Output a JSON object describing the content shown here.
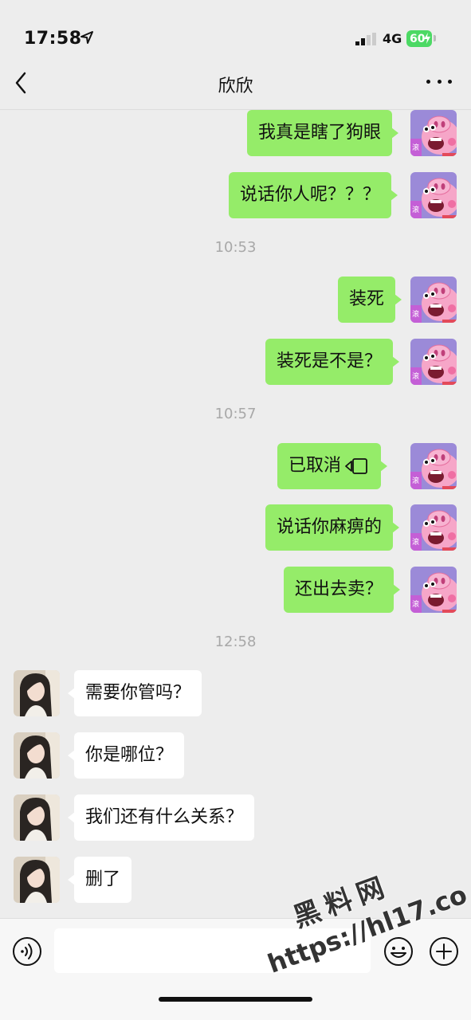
{
  "status": {
    "time": "17:58",
    "network": "4G",
    "battery": "60"
  },
  "nav": {
    "title": "欣欣"
  },
  "messages": {
    "m1": "我真是瞎了狗眼",
    "m2": "说话你人呢？？？",
    "t1": "10:53",
    "m3": "装死",
    "m4": "装死是不是？",
    "t2": "10:57",
    "m5": "已取消",
    "m6": "说话你麻痹的",
    "m7": "还出去卖？",
    "t3": "12:58",
    "r1": "需要你管吗？",
    "r2": "你是哪位？",
    "r3": "我们还有什么关系？",
    "r4": "删了"
  },
  "avatar_badge": "滚",
  "input": {
    "value": ""
  },
  "watermark": {
    "line1": "黑料网",
    "line2": "https://hl17.co"
  },
  "colors": {
    "outgoing": "#95ec69",
    "incoming": "#ffffff",
    "background": "#ededed"
  },
  "icons": [
    "back-chevron",
    "more-dots",
    "voice",
    "emoji",
    "plus",
    "video-call",
    "location-arrow",
    "signal"
  ]
}
